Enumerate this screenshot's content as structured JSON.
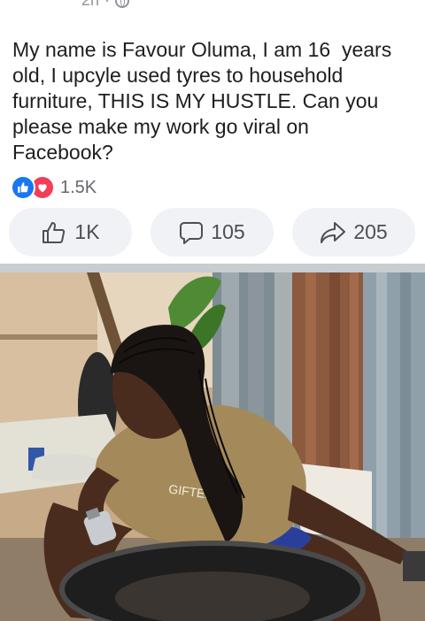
{
  "post": {
    "time": "2h",
    "text": "My name is Favour Oluma, I am 16  years old, I upcyle used tyres to household furniture, THIS IS MY HUSTLE. Can you please make my work go viral on Facebook?"
  },
  "reactions": {
    "count": "1.5K",
    "types": [
      "like-icon",
      "love-icon"
    ]
  },
  "actions": {
    "like": {
      "icon": "thumbs-up-icon",
      "label": "1K"
    },
    "comment": {
      "icon": "comment-bubble-icon",
      "label": "105"
    },
    "share": {
      "icon": "share-arrow-icon",
      "label": "205"
    }
  },
  "photo": {
    "shirt_text": "GIFTED"
  },
  "colors": {
    "accent": "#1877f2",
    "love": "#f33e58",
    "button_bg": "#f0f2f5",
    "separator": "#c9ccd1"
  }
}
